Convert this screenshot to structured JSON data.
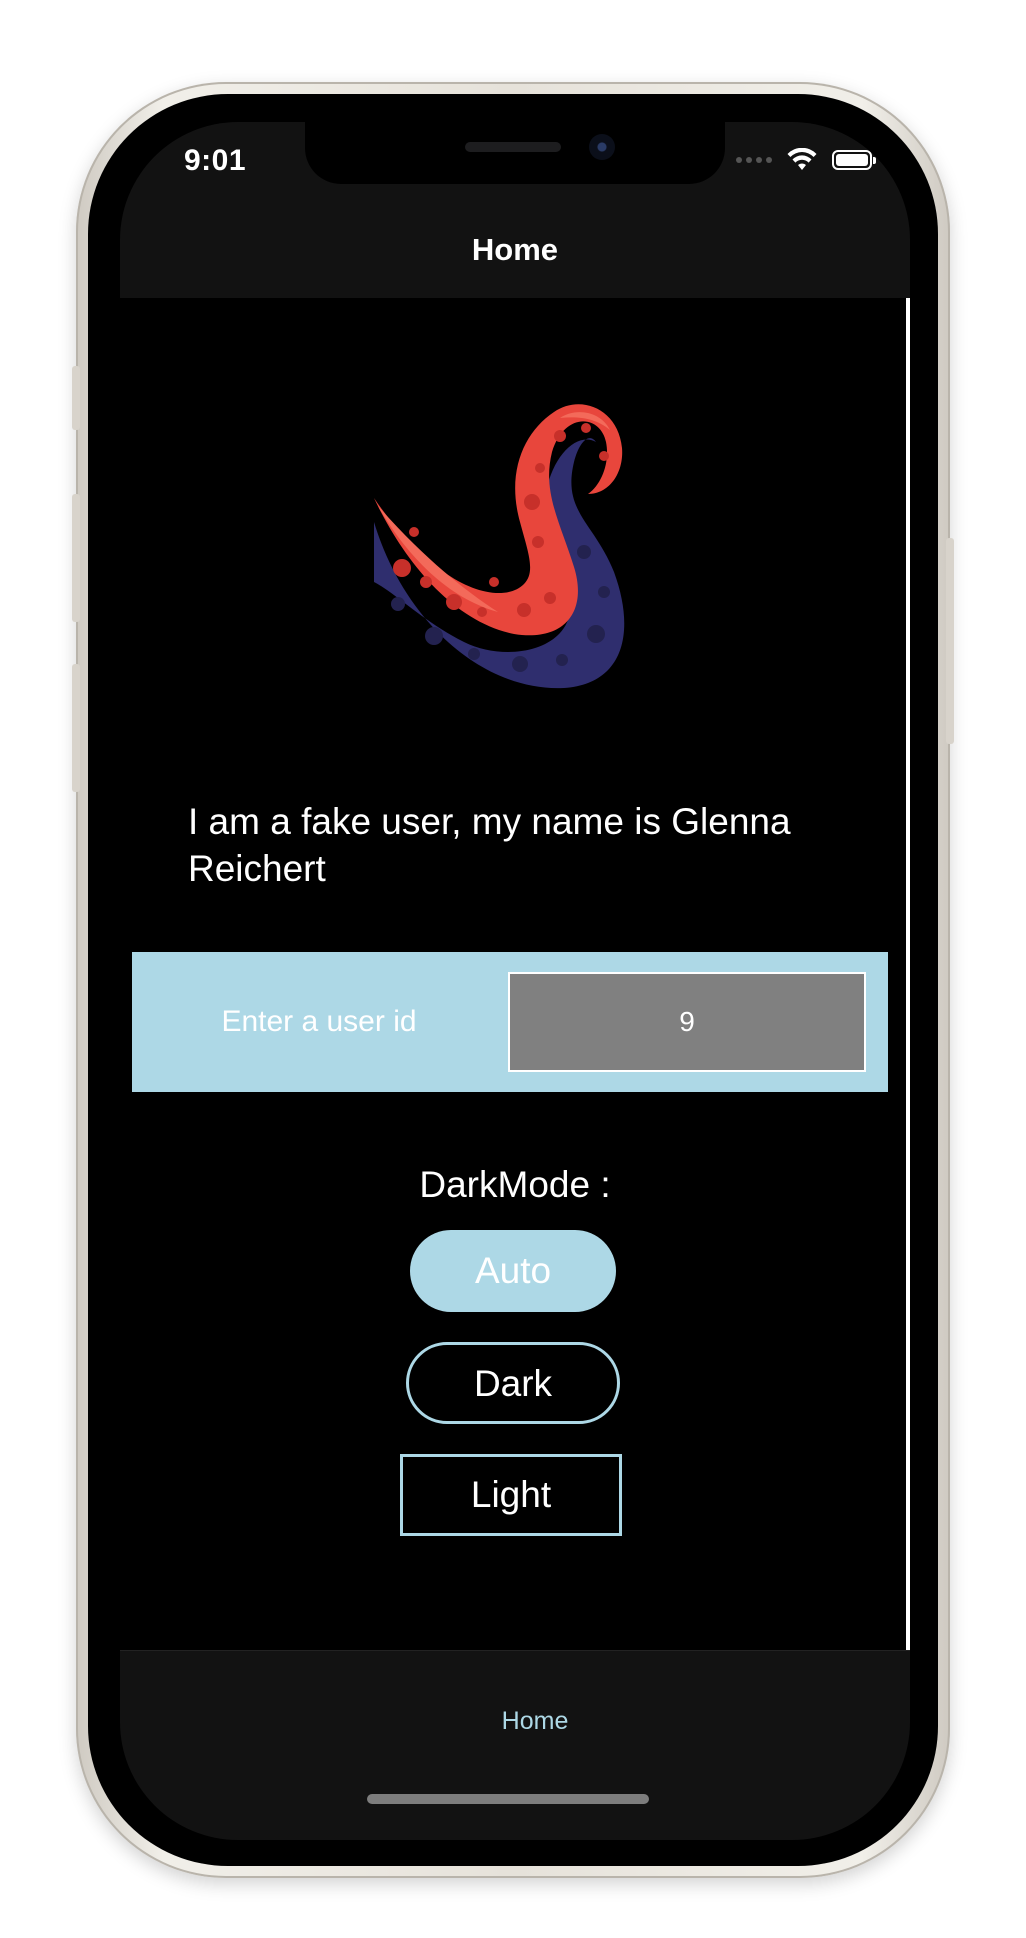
{
  "status_bar": {
    "time": "9:01"
  },
  "nav": {
    "title": "Home"
  },
  "main": {
    "logo_icon": "tentacle-logo-icon",
    "intro_text": "I am a fake user, my name is Glenna Reichert",
    "user_id": {
      "label": "Enter a user id",
      "value": "9"
    },
    "darkmode": {
      "label": "DarkMode :",
      "options": [
        "Auto",
        "Dark",
        "Light"
      ],
      "selected": "Auto"
    }
  },
  "tabbar": {
    "items": [
      {
        "label": "Home",
        "active": true
      }
    ]
  },
  "colors": {
    "accent": "#add8e6",
    "input_bg": "#808080",
    "background": "#000000",
    "bar_bg": "#121212"
  }
}
